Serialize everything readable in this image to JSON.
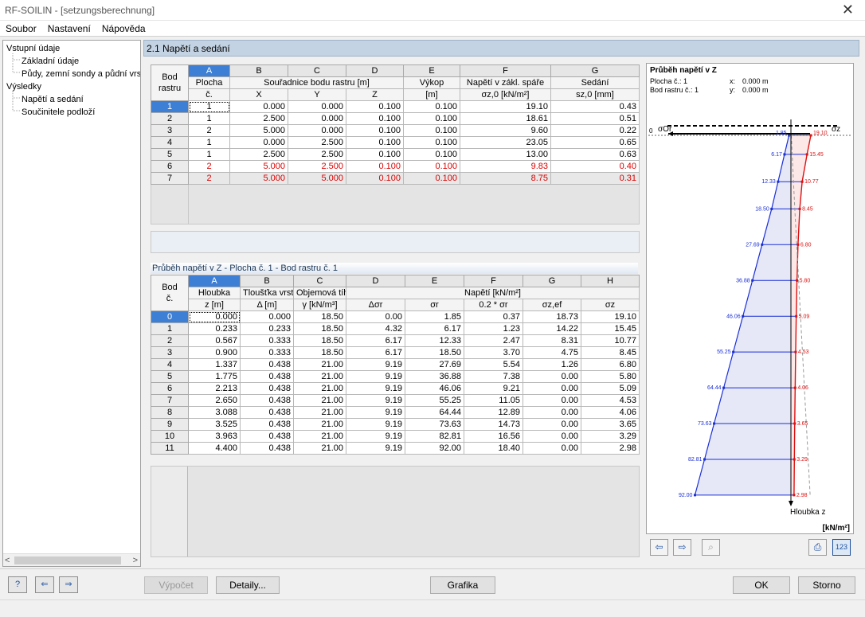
{
  "window": {
    "title": "RF-SOILIN - [setzungsberechnung]"
  },
  "menu": [
    "Soubor",
    "Nastavení",
    "Nápověda"
  ],
  "tree": {
    "items": [
      {
        "label": "Vstupní údaje",
        "level": 0
      },
      {
        "label": "Základní údaje",
        "level": 1
      },
      {
        "label": "Půdy, zemní sondy a půdní vrstvy",
        "level": 1
      },
      {
        "label": "Výsledky",
        "level": 0
      },
      {
        "label": "Napětí a sedání",
        "level": 1
      },
      {
        "label": "Součinitele podloží",
        "level": 1
      }
    ]
  },
  "section_title": "2.1 Napětí a sedání",
  "table1": {
    "col_letters": [
      "A",
      "B",
      "C",
      "D",
      "E",
      "F",
      "G"
    ],
    "rowhead_label_1": "Bod",
    "rowhead_label_2": "rastru",
    "h_plocha_1": "Plocha",
    "h_plocha_2": "č.",
    "h_coord": "Souřadnice bodu rastru [m]",
    "h_x": "X",
    "h_y": "Y",
    "h_z": "Z",
    "h_vykop_1": "Výkop",
    "h_vykop_2": "[m]",
    "h_napeti_1": "Napětí v zákl. spáře",
    "h_napeti_2": "σz,0 [kN/m²]",
    "h_sedani_1": "Sedání",
    "h_sedani_2": "sz,0 [mm]",
    "rows": [
      {
        "id": "1",
        "plocha": "1",
        "x": "0.000",
        "y": "0.000",
        "z": "0.100",
        "vykop": "0.100",
        "napeti": "19.10",
        "sedani": "0.43"
      },
      {
        "id": "2",
        "plocha": "1",
        "x": "2.500",
        "y": "0.000",
        "z": "0.100",
        "vykop": "0.100",
        "napeti": "18.61",
        "sedani": "0.51"
      },
      {
        "id": "3",
        "plocha": "2",
        "x": "5.000",
        "y": "0.000",
        "z": "0.100",
        "vykop": "0.100",
        "napeti": "9.60",
        "sedani": "0.22"
      },
      {
        "id": "4",
        "plocha": "1",
        "x": "0.000",
        "y": "2.500",
        "z": "0.100",
        "vykop": "0.100",
        "napeti": "23.05",
        "sedani": "0.65"
      },
      {
        "id": "5",
        "plocha": "1",
        "x": "2.500",
        "y": "2.500",
        "z": "0.100",
        "vykop": "0.100",
        "napeti": "13.00",
        "sedani": "0.63"
      },
      {
        "id": "6",
        "plocha": "2",
        "x": "5.000",
        "y": "2.500",
        "z": "0.100",
        "vykop": "0.100",
        "napeti": "9.83",
        "sedani": "0.40"
      },
      {
        "id": "7",
        "plocha": "2",
        "x": "5.000",
        "y": "5.000",
        "z": "0.100",
        "vykop": "0.100",
        "napeti": "8.75",
        "sedani": "0.31"
      }
    ]
  },
  "table2": {
    "title": "Průběh napětí v Z  -  Plocha č. 1  -  Bod rastru č. 1",
    "col_letters": [
      "A",
      "B",
      "C",
      "D",
      "E",
      "F",
      "G",
      "H"
    ],
    "rowhead_label_1": "Bod",
    "rowhead_label_2": "č.",
    "h_hloubka_1": "Hloubka",
    "h_hloubka_2": "z [m]",
    "h_tloustka_1": "Tloušťka vrstvy",
    "h_tloustka_2": "Δ [m]",
    "h_objem_1": "Objemová tíha",
    "h_objem_2": "γ [kN/m³]",
    "h_napeti": "Napětí [kN/m²]",
    "h_d": "Δσr",
    "h_e": "σr",
    "h_f": "0.2 * σr",
    "h_g": "σz,ef",
    "h_h": "σz",
    "rows": [
      {
        "id": "0",
        "z": "0.000",
        "d": "0.000",
        "g": "18.50",
        "ds": "0.00",
        "sr": "1.85",
        "f02": "0.37",
        "sef": "18.73",
        "sz": "19.10"
      },
      {
        "id": "1",
        "z": "0.233",
        "d": "0.233",
        "g": "18.50",
        "ds": "4.32",
        "sr": "6.17",
        "f02": "1.23",
        "sef": "14.22",
        "sz": "15.45"
      },
      {
        "id": "2",
        "z": "0.567",
        "d": "0.333",
        "g": "18.50",
        "ds": "6.17",
        "sr": "12.33",
        "f02": "2.47",
        "sef": "8.31",
        "sz": "10.77"
      },
      {
        "id": "3",
        "z": "0.900",
        "d": "0.333",
        "g": "18.50",
        "ds": "6.17",
        "sr": "18.50",
        "f02": "3.70",
        "sef": "4.75",
        "sz": "8.45"
      },
      {
        "id": "4",
        "z": "1.337",
        "d": "0.438",
        "g": "21.00",
        "ds": "9.19",
        "sr": "27.69",
        "f02": "5.54",
        "sef": "1.26",
        "sz": "6.80"
      },
      {
        "id": "5",
        "z": "1.775",
        "d": "0.438",
        "g": "21.00",
        "ds": "9.19",
        "sr": "36.88",
        "f02": "7.38",
        "sef": "0.00",
        "sz": "5.80"
      },
      {
        "id": "6",
        "z": "2.213",
        "d": "0.438",
        "g": "21.00",
        "ds": "9.19",
        "sr": "46.06",
        "f02": "9.21",
        "sef": "0.00",
        "sz": "5.09"
      },
      {
        "id": "7",
        "z": "2.650",
        "d": "0.438",
        "g": "21.00",
        "ds": "9.19",
        "sr": "55.25",
        "f02": "11.05",
        "sef": "0.00",
        "sz": "4.53"
      },
      {
        "id": "8",
        "z": "3.088",
        "d": "0.438",
        "g": "21.00",
        "ds": "9.19",
        "sr": "64.44",
        "f02": "12.89",
        "sef": "0.00",
        "sz": "4.06"
      },
      {
        "id": "9",
        "z": "3.525",
        "d": "0.438",
        "g": "21.00",
        "ds": "9.19",
        "sr": "73.63",
        "f02": "14.73",
        "sef": "0.00",
        "sz": "3.65"
      },
      {
        "id": "10",
        "z": "3.963",
        "d": "0.438",
        "g": "21.00",
        "ds": "9.19",
        "sr": "82.81",
        "f02": "16.56",
        "sef": "0.00",
        "sz": "3.29"
      },
      {
        "id": "11",
        "z": "4.400",
        "d": "0.438",
        "g": "21.00",
        "ds": "9.19",
        "sr": "92.00",
        "f02": "18.40",
        "sef": "0.00",
        "sz": "2.98"
      }
    ]
  },
  "chart_data": {
    "type": "line",
    "title": "Průběh napětí v Z",
    "info": {
      "plocha_label": "Plocha č.: 1",
      "bod_label": "Bod rastru č.: 1",
      "x_label": "x:",
      "x_val": "0.000 m",
      "y_label": "y:",
      "y_val": "0.000 m"
    },
    "zero_label": "0",
    "sigma_r_label": "σOr",
    "sigma_z_label": "σz",
    "depth_label": "Hloubka z",
    "unit_label": "[kN/m²]",
    "depth": [
      0.0,
      0.233,
      0.567,
      0.9,
      1.337,
      1.775,
      2.213,
      2.65,
      3.088,
      3.525,
      3.963,
      4.4
    ],
    "series": [
      {
        "name": "σr",
        "values": [
          1.85,
          6.17,
          12.33,
          18.5,
          27.69,
          36.88,
          46.06,
          55.25,
          64.44,
          73.63,
          82.81,
          92.0
        ],
        "labels": [
          "1.85",
          "6.17",
          "12.33",
          "18.50",
          "27.69",
          "36.88",
          "46.06",
          "55.25",
          "64.44",
          "73.63",
          "82.81",
          "92.00"
        ],
        "color": "#1a2fd6"
      },
      {
        "name": "σz",
        "values": [
          19.1,
          15.45,
          10.77,
          8.45,
          6.8,
          5.8,
          5.09,
          4.53,
          4.06,
          3.65,
          3.29,
          2.98
        ],
        "labels": [
          "19.10",
          "15.45",
          "10.77",
          "8.45",
          "6.80",
          "5.80",
          "5.09",
          "4.53",
          "4.06",
          "3.65",
          "3.29",
          "2.98"
        ],
        "color": "#dd1111"
      },
      {
        "name": "0.2 * σr",
        "values": [
          0.37,
          1.23,
          2.47,
          3.7,
          5.54,
          7.38,
          9.21,
          11.05,
          12.89,
          14.73,
          16.56,
          18.4
        ],
        "color": "#999999"
      }
    ]
  },
  "buttons": {
    "vypocet": "Výpočet",
    "detaily": "Detaily...",
    "grafika": "Grafika",
    "ok": "OK",
    "storno": "Storno",
    "chart_table_icon": "123"
  }
}
